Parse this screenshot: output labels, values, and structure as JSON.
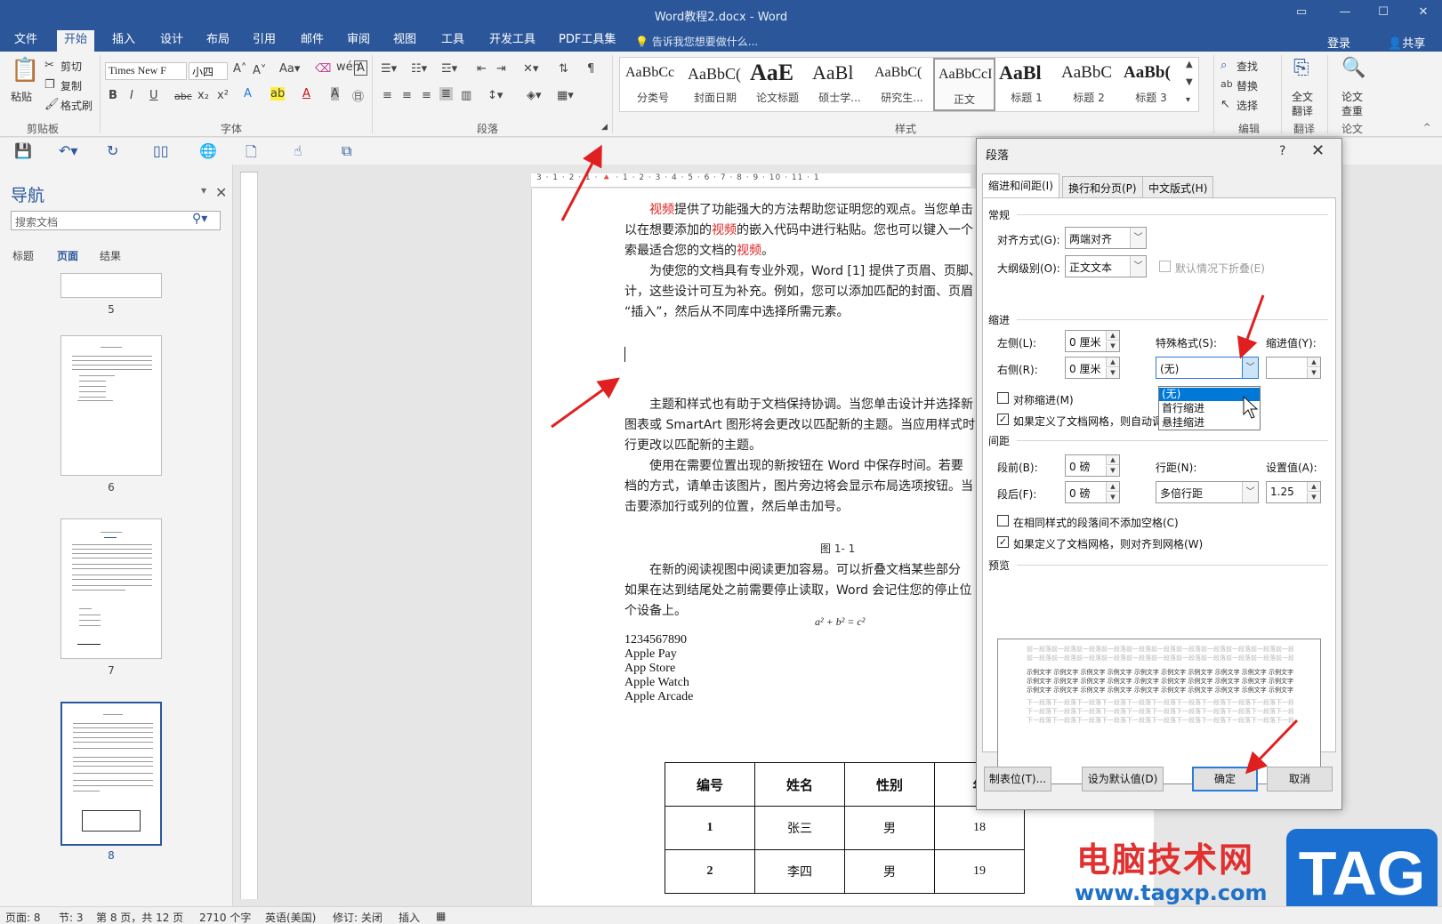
{
  "titlebar": {
    "title": "Word教程2.docx - Word"
  },
  "menu": {
    "tabs": [
      "文件",
      "开始",
      "插入",
      "设计",
      "布局",
      "引用",
      "邮件",
      "审阅",
      "视图",
      "工具",
      "开发工具",
      "PDF工具集"
    ],
    "active": "开始",
    "tellme": "告诉我您想要做什么...",
    "login": "登录",
    "share": "共享"
  },
  "ribbon": {
    "clipboard": {
      "paste": "粘贴",
      "cut": "剪切",
      "copy": "复制",
      "format_painter": "格式刷",
      "label": "剪贴板"
    },
    "font": {
      "name": "Times New F",
      "size": "小四",
      "label": "字体"
    },
    "paragraph": {
      "label": "段落"
    },
    "styles": {
      "label": "样式",
      "items": [
        {
          "preview": "AaBbCc",
          "name": "分类号"
        },
        {
          "preview": "AaBbC(",
          "name": "封面日期"
        },
        {
          "preview": "AaE",
          "name": "论文标题"
        },
        {
          "preview": "AaBl",
          "name": "硕士学..."
        },
        {
          "preview": "AaBbC(",
          "name": "研究生..."
        },
        {
          "preview": "AaBbCcI",
          "name": "正文"
        },
        {
          "preview": "AaBl",
          "name": "标题 1"
        },
        {
          "preview": "AaBbC",
          "name": "标题 2"
        },
        {
          "preview": "AaBb(",
          "name": "标题 3"
        }
      ]
    },
    "editing": {
      "find": "查找",
      "replace": "替换",
      "select": "选择",
      "label": "编辑"
    },
    "translate": {
      "full": "全文",
      "translate": "翻译",
      "label": "翻译"
    },
    "check": {
      "line1": "论文",
      "line2": "查重",
      "label": "论文"
    }
  },
  "nav": {
    "title": "导航",
    "search_placeholder": "搜索文档",
    "tabs": [
      "标题",
      "页面",
      "结果"
    ],
    "active_tab": "页面",
    "pages": [
      "5",
      "6",
      "7",
      "8"
    ],
    "selected_page": "8"
  },
  "ruler": {
    "marks": "3 · 1 · 2 · 1 · 🔺 · 1 · 2 · 3 · 4 · 5 · 6 · 7 · 8 · 9 · 10 · 11 · 1"
  },
  "document": {
    "p1": [
      "视频",
      "提供了功能强大的方法帮助您证明您的观点。当您单击",
      "以在想要添加的",
      "视频",
      "的嵌入代码中进行粘贴。您也可以键入一个",
      "索最适合您的文档的",
      "视频",
      "。"
    ],
    "p2": [
      "为使您的文档具有专业外观，Word [1] 提供了页眉、页脚、",
      "计，这些设计可互为补充。例如，您可以添加匹配的封面、页眉",
      "“插入”，然后从不同库中选择所需元素。"
    ],
    "p3": [
      "主题和样式也有助于文档保持协调。当您单击设计并选择新",
      "图表或 SmartArt 图形将会更改以匹配新的主题。当应用样式时",
      "行更改以匹配新的主题。"
    ],
    "p4": [
      "使用在需要位置出现的新按钮在 Word 中保存时间。若要",
      "档的方式，请单击该图片，图片旁边将会显示布局选项按钮。当",
      "击要添加行或列的位置，然后单击加号。"
    ],
    "caption": "图 1- 1",
    "p5": [
      "在新的阅读视图中阅读更加容易。可以折叠文档某些部分",
      "如果在达到结尾处之前需要停止读取，Word 会记住您的停止位",
      "个设备上。"
    ],
    "formula": "a² + b² = c²",
    "list": [
      "1234567890",
      "Apple Pay",
      "App Store",
      "Apple Watch",
      "Apple Arcade"
    ],
    "table": {
      "headers": [
        "编号",
        "姓名",
        "性别",
        "年"
      ],
      "rows": [
        [
          "1",
          "张三",
          "男",
          "18"
        ],
        [
          "2",
          "李四",
          "男",
          "19"
        ]
      ]
    }
  },
  "status": {
    "page": "页面: 8",
    "section": "节: 3",
    "pages": "第 8 页，共 12 页",
    "words": "2710 个字",
    "lang": "英语(美国)",
    "revision": "修订: 关闭",
    "insert": "插入"
  },
  "dialog": {
    "title": "段落",
    "help": "?",
    "tabs": [
      "缩进和间距(I)",
      "换行和分页(P)",
      "中文版式(H)"
    ],
    "active_tab": "缩进和间距(I)",
    "general": {
      "label": "常规",
      "alignment_label": "对齐方式(G):",
      "alignment": "两端对齐",
      "outline_label": "大纲级别(O):",
      "outline": "正文文本",
      "collapse_label": "默认情况下折叠(E)"
    },
    "indent": {
      "label": "缩进",
      "left_label": "左侧(L):",
      "left": "0 厘米",
      "right_label": "右侧(R):",
      "right": "0 厘米",
      "special_label": "特殊格式(S):",
      "special": "(无)",
      "by_label": "缩进值(Y):",
      "by": "",
      "mirror_label": "对称缩进(M)",
      "grid_label": "如果定义了文档网格，则自动调",
      "options": [
        "(无)",
        "首行缩进",
        "悬挂缩进"
      ]
    },
    "spacing": {
      "label": "间距",
      "before_label": "段前(B):",
      "before": "0 磅",
      "after_label": "段后(F):",
      "after": "0 磅",
      "line_label": "行距(N):",
      "line": "多倍行距",
      "at_label": "设置值(A):",
      "at": "1.25",
      "nospace_label": "在相同样式的段落间不添加空格(C)",
      "snap_label": "如果定义了文档网格，则对齐到网格(W)"
    },
    "preview": {
      "label": "预览",
      "before_text": "前一段落前一段落前一段落前一段落前一段落前一段落前一段落前一段落前一段落前一段落前一段落前一段落前一段落前一段落前一段落前一段落前一段落前一段落前一段落前一段落",
      "sample_text": "示例文字 示例文字 示例文字 示例文字 示例文字 示例文字 示例文字 示例文字 示例文字 示例文字 示例文字 示例文字 示例文字 示例文字 示例文字 示例文字 示例文字 示例文字 示例文字 示例文字 示例文字 示例文字 示例文字 示例文字 示例文字 示例文字",
      "after_text": "下一段落下一段落下一段落下一段落下一段落下一段落下一段落下一段落下一段落下一段落下一段落下一段落下一段落下一段落下一段落下一段落下一段落下一段落下一段落"
    },
    "buttons": {
      "tabs": "制表位(T)...",
      "default": "设为默认值(D)",
      "ok": "确定",
      "cancel": "取消"
    }
  },
  "watermark": {
    "text": "电脑技术网",
    "url": "www.tagxp.com",
    "tag": "TAG"
  },
  "colors": {
    "brand": "#2b579a",
    "annotation": "#e02020",
    "accent": "#0078d7"
  }
}
